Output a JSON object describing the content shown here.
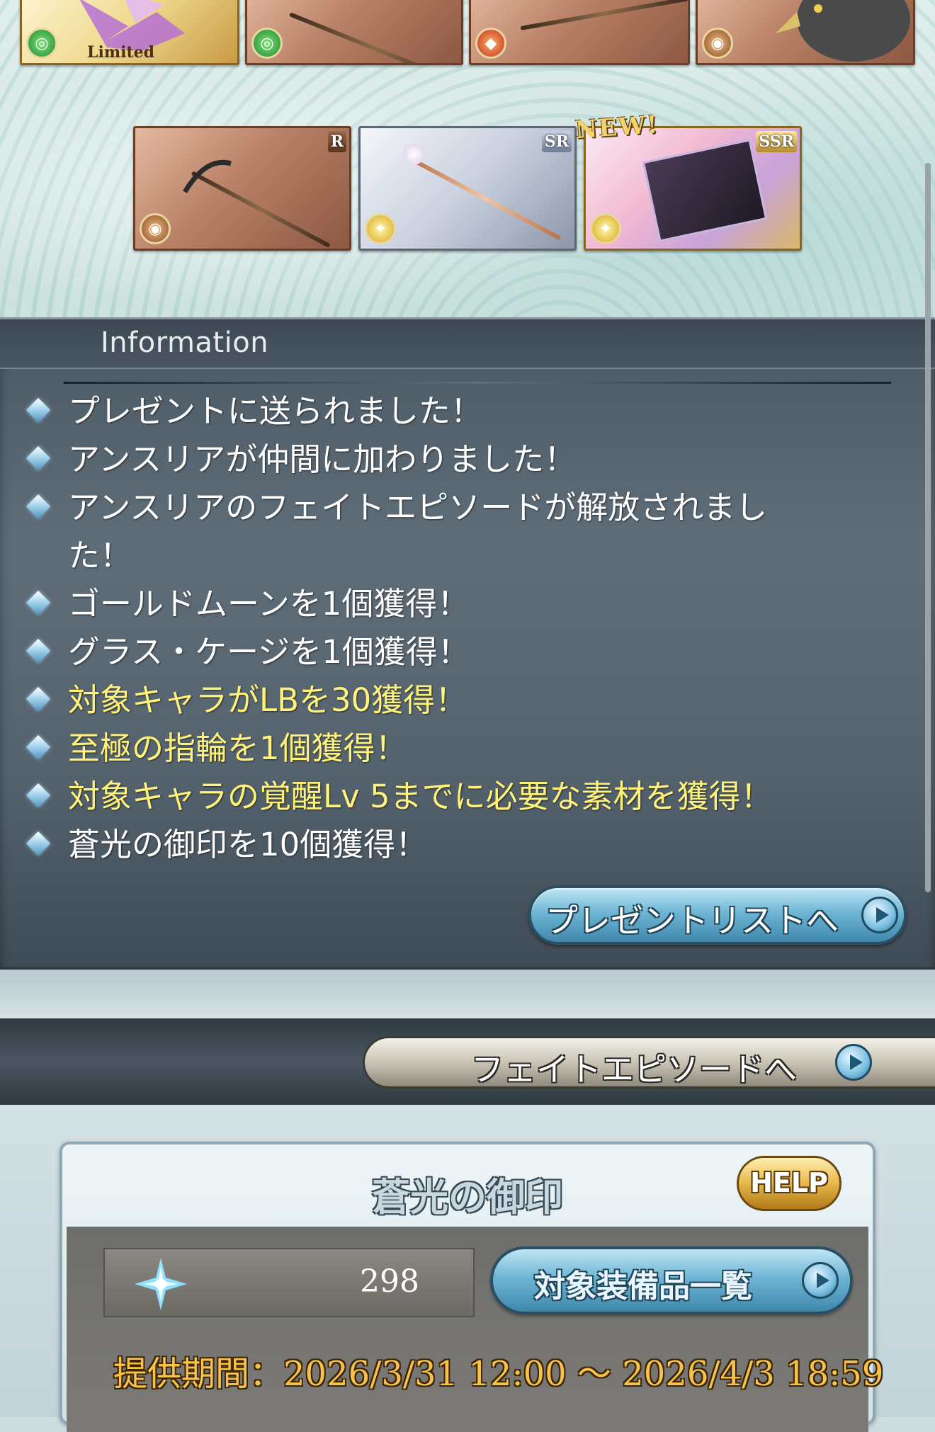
{
  "items": {
    "limited_label": "Limited",
    "new_label": "NEW!",
    "row1": [
      {
        "element": "wind-icon",
        "rarity": ""
      },
      {
        "element": "wind-icon",
        "rarity": ""
      },
      {
        "element": "fire-icon",
        "rarity": ""
      },
      {
        "element": "earth-icon",
        "rarity": ""
      }
    ],
    "row2": [
      {
        "element": "earth-icon",
        "rarity": "R"
      },
      {
        "element": "light-icon",
        "rarity": "SR"
      },
      {
        "element": "light-icon",
        "rarity": "SSR"
      }
    ]
  },
  "information": {
    "title": "Information",
    "messages": [
      {
        "text": "プレゼントに送られました！",
        "highlight": false
      },
      {
        "text": "アンスリアが仲間に加わりました！",
        "highlight": false
      },
      {
        "text": "アンスリアのフェイトエピソードが解放されました！",
        "highlight": false
      },
      {
        "text": "ゴールドムーンを1個獲得！",
        "highlight": false
      },
      {
        "text": "グラス・ケージを1個獲得！",
        "highlight": false
      },
      {
        "text": "対象キャラがLBを30獲得！",
        "highlight": true
      },
      {
        "text": "至極の指輪を1個獲得！",
        "highlight": true
      },
      {
        "text": "対象キャラの覚醒Lv 5までに必要な素材を獲得！",
        "highlight": true
      },
      {
        "text": "蒼光の御印を10個獲得！",
        "highlight": false
      }
    ],
    "present_button": "プレゼントリストへ"
  },
  "fate_button": "フェイトエピソードへ",
  "seal": {
    "title": "蒼光の御印",
    "help": "HELP",
    "count": "298",
    "equip_button": "対象装備品一覧",
    "period": "提供期間：2026/3/31 12:00 〜 2026/4/3 18:59"
  },
  "colors": {
    "highlight_text": "#fff27a",
    "period_text": "#f6c24a",
    "panel_bg": "#55636e"
  }
}
